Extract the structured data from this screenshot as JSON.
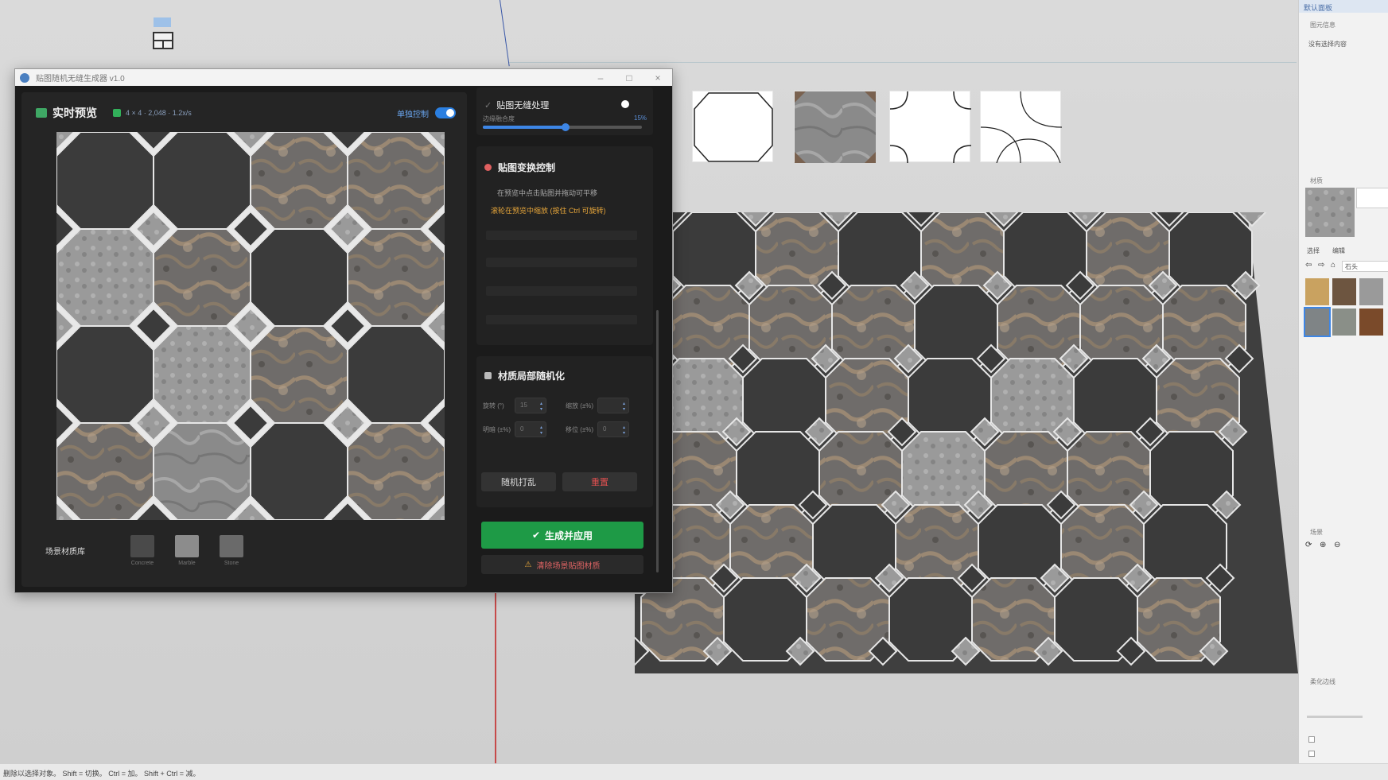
{
  "window": {
    "title": "贴图随机无缝生成器 v1.0"
  },
  "preview": {
    "title": "实时预览",
    "stats": "4 × 4 · 2,048 · 1.2x/s",
    "switch_label": "单独控制",
    "scene_label": "场景材质库",
    "scene_items": [
      {
        "name": "Concrete",
        "color": "#4a4a4a"
      },
      {
        "name": "Marble",
        "color": "#8c8c8c"
      },
      {
        "name": "Stone",
        "color": "#6a6a6a"
      }
    ]
  },
  "seamless": {
    "title": "贴图无缝处理",
    "slider_label": "边缘融合度",
    "slider_value": "15%",
    "slider_fraction": 0.52
  },
  "transform": {
    "title": "贴图变换控制",
    "note": "在预览中点击贴图并拖动可平移",
    "warning": "滚轮在预览中缩放 (按住 Ctrl 可旋转)"
  },
  "randomize": {
    "title": "材质局部随机化",
    "fields": [
      {
        "label": "旋转 (°)",
        "value": "15"
      },
      {
        "label": "缩放 (±%)",
        "value": ""
      },
      {
        "label": "明暗 (±%)",
        "value": "0"
      },
      {
        "label": "移位 (±%)",
        "value": "0"
      }
    ],
    "btn_random": "随机打乱",
    "btn_reset": "重置"
  },
  "actions": {
    "generate": "生成并应用",
    "clear": "清除场景贴图材质"
  },
  "tray": {
    "header": "默认面板",
    "entity_info": "图元信息",
    "empty_msg": "没有选择内容",
    "materials": "材质",
    "tab_select": "选择",
    "tab_edit": "编辑",
    "mat_search": "石头",
    "layers": "场景",
    "soften": "柔化边线",
    "material_colors": [
      "#c9a260",
      "#6d5540",
      "#9a9a9a",
      "#7f8486",
      "#8a8f88",
      "#7a4a2a"
    ]
  },
  "statusbar": {
    "text": "删除以选择对象。 Shift = 切换。 Ctrl = 加。 Shift + Ctrl = 减。"
  },
  "colors": {
    "accent_blue": "#2b7fe0",
    "accent_green": "#1e9a46",
    "warn_orange": "#e7a63a",
    "danger_red": "#e06464"
  }
}
